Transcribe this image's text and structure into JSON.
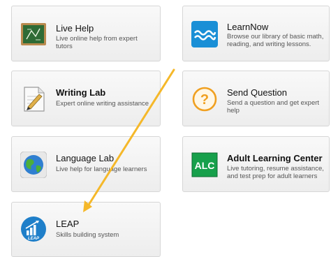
{
  "tiles": {
    "live_help": {
      "title": "Live Help",
      "desc": "Live online help from expert tutors"
    },
    "learnnow": {
      "title": "LearnNow",
      "desc": "Browse our library of basic math, reading, and writing lessons."
    },
    "writing_lab": {
      "title": "Writing Lab",
      "desc": "Expert online writing assistance"
    },
    "send_question": {
      "title": "Send Question",
      "desc": "Send a question and get expert help"
    },
    "language_lab": {
      "title": "Language Lab",
      "desc": "Live help for language learners"
    },
    "adult_learning": {
      "title": "Adult Learning Center",
      "desc": "Live tutoring, resume assistance, and test prep for adult learners",
      "icon_text": "ALC"
    },
    "leap": {
      "title": "LEAP",
      "desc": "Skills building system",
      "icon_text": "LEAP"
    }
  },
  "icons": {
    "live_help": "chalkboard-icon",
    "learnnow": "waves-icon",
    "writing_lab": "pencil-paper-icon",
    "send_question": "question-mark-icon",
    "language_lab": "globe-icon",
    "adult_learning": "alc-icon",
    "leap": "bar-chart-arrow-icon"
  },
  "annotation": {
    "arrow_color": "#f5b82a"
  }
}
